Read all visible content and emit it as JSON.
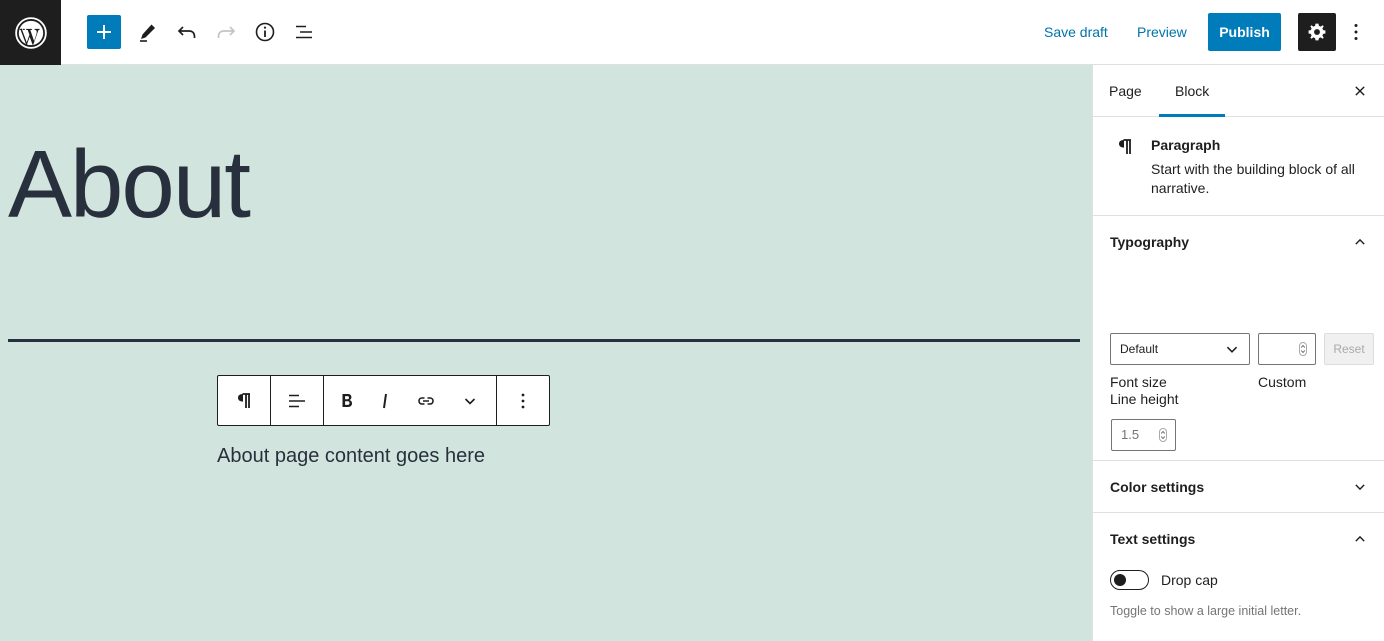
{
  "topbar": {
    "save_draft": "Save draft",
    "preview": "Preview",
    "publish": "Publish",
    "icons": [
      "wordpress-logo",
      "plus",
      "pencil",
      "undo",
      "redo",
      "info",
      "list-view",
      "gear",
      "more-vertical"
    ]
  },
  "editor": {
    "page_title": "About",
    "paragraph_text": "About page content goes here",
    "background_color": "#d1e4dd",
    "text_color": "#28303d",
    "block_toolbar": [
      "paragraph",
      "align-left",
      "bold",
      "italic",
      "link",
      "chevron-down",
      "more-vertical"
    ]
  },
  "sidebar": {
    "tabs": [
      {
        "label": "Page",
        "active": false
      },
      {
        "label": "Block",
        "active": true
      }
    ],
    "block_card": {
      "title": "Paragraph",
      "description": "Start with the building block of all narrative."
    },
    "typography": {
      "title": "Typography",
      "font_size_label": "Font size",
      "custom_label": "Custom",
      "font_size_value": "Default",
      "reset_label": "Reset",
      "line_height_label": "Line height",
      "line_height_value": "1.5"
    },
    "color_settings": {
      "title": "Color settings"
    },
    "text_settings": {
      "title": "Text settings",
      "drop_cap_label": "Drop cap",
      "drop_cap_help": "Toggle to show a large initial letter."
    }
  },
  "colors": {
    "accent": "#007cba",
    "dark": "#1e1e1e"
  }
}
